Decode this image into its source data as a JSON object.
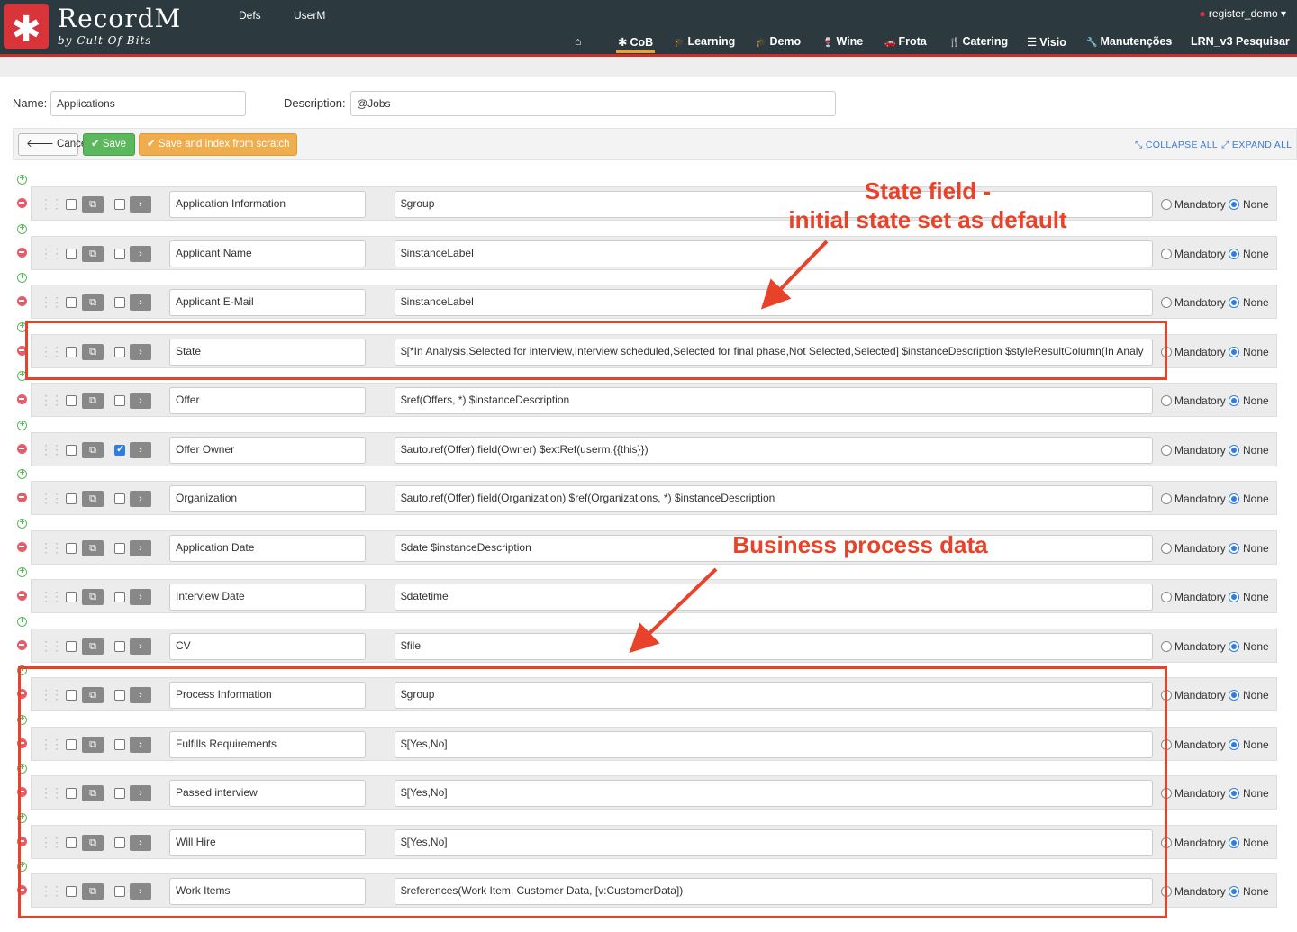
{
  "app": {
    "logo_symbol": "✱",
    "title": "RecordM",
    "subtitle": "by Cult Of Bits"
  },
  "top_menu": [
    "Defs",
    "UserM"
  ],
  "user_menu": {
    "label": "register_demo",
    "caret": "▾"
  },
  "nav": [
    {
      "label": "",
      "icon": "home-icon",
      "glyph": "⌂"
    },
    {
      "label": "CoB",
      "icon": "asterisk-icon",
      "glyph": "✱",
      "active": true
    },
    {
      "label": "Learning",
      "icon": "graduation-cap-icon",
      "glyph": "🎓"
    },
    {
      "label": "Demo",
      "icon": "graduation-cap-icon",
      "glyph": "🎓"
    },
    {
      "label": "Wine",
      "icon": "glass-icon",
      "glyph": "🍷"
    },
    {
      "label": "Frota",
      "icon": "car-icon",
      "glyph": "🚗"
    },
    {
      "label": "Catering",
      "icon": "cutlery-icon",
      "glyph": "🍴"
    },
    {
      "label": "Visio",
      "icon": "database-icon",
      "glyph": "☰"
    },
    {
      "label": "Manutenções",
      "icon": "wrench-icon",
      "glyph": "🔧"
    },
    {
      "label": "LRN_v3 Pesquisar",
      "icon": "",
      "glyph": ""
    }
  ],
  "form": {
    "name_label": "Name:",
    "name_value": "Applications",
    "description_label": "Description:",
    "description_value": "@Jobs"
  },
  "toolbar": {
    "cancel_label": "Cancel",
    "cancel_glyph": "🡐",
    "save_label": "Save",
    "save_glyph": "✔",
    "save_index_label": "Save and index from scratch",
    "save_index_glyph": "✔",
    "collapse_label": "COLLAPSE ALL",
    "expand_label": "EXPAND ALL",
    "collapse_glyph": "⤡",
    "expand_glyph": "⤢"
  },
  "radio_labels": {
    "mandatory": "Mandatory",
    "none": "None"
  },
  "fields": [
    {
      "name": "Application Information",
      "description": "$group",
      "checked": false
    },
    {
      "name": "Applicant Name",
      "description": "$instanceLabel",
      "checked": false
    },
    {
      "name": "Applicant E-Mail",
      "description": "$instanceLabel",
      "checked": false
    },
    {
      "name": "State",
      "description": "$[*In Analysis,Selected for interview,Interview scheduled,Selected for final phase,Not Selected,Selected] $instanceDescription $styleResultColumn(In Analy",
      "checked": false
    },
    {
      "name": "Offer",
      "description": "$ref(Offers, *) $instanceDescription",
      "checked": false
    },
    {
      "name": "Offer Owner",
      "description": "$auto.ref(Offer).field(Owner) $extRef(userm,{{this}})",
      "checked": true
    },
    {
      "name": "Organization",
      "description": "$auto.ref(Offer).field(Organization) $ref(Organizations, *) $instanceDescription",
      "checked": false
    },
    {
      "name": "Application Date",
      "description": "$date $instanceDescription",
      "checked": false
    },
    {
      "name": "Interview Date",
      "description": "$datetime",
      "checked": false
    },
    {
      "name": "CV",
      "description": "$file",
      "checked": false
    },
    {
      "name": "Process Information",
      "description": "$group",
      "checked": false
    },
    {
      "name": "Fulfills Requirements",
      "description": "$[Yes,No]",
      "checked": false
    },
    {
      "name": "Passed interview",
      "description": "$[Yes,No]",
      "checked": false
    },
    {
      "name": "Will Hire",
      "description": "$[Yes,No]",
      "checked": false
    },
    {
      "name": "Work Items",
      "description": "$references(Work Item, Customer Data, [v:CustomerData])",
      "checked": false
    }
  ],
  "annotations": {
    "state_line1": "State field -",
    "state_line2": "initial state set as default",
    "business": "Business process data",
    "color": "#e8432a"
  }
}
